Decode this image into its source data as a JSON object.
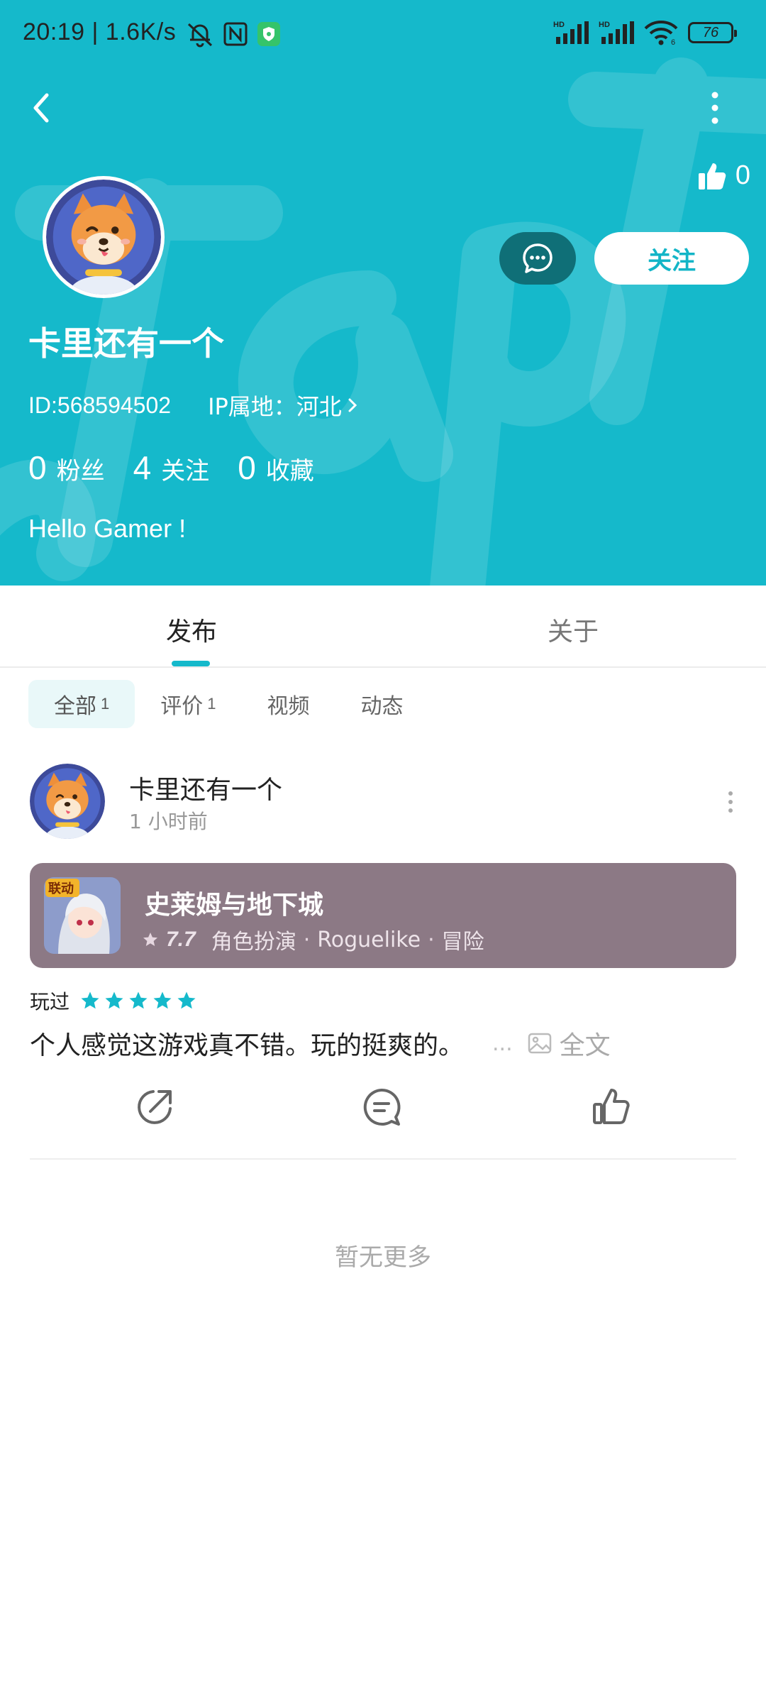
{
  "status_bar": {
    "time": "20:19 | 1.6K/s",
    "battery": "76",
    "net_left": "HD",
    "net_right": "HD",
    "wifi_badge": "6"
  },
  "header": {
    "bg_color": "#15b9cb",
    "likes_count": "0",
    "follow_label": "关注",
    "username": "卡里还有一个",
    "user_id": "ID:568594502",
    "ip_location": "IP属地：河北",
    "stats": [
      {
        "num": "0",
        "label": "粉丝"
      },
      {
        "num": "4",
        "label": "关注"
      },
      {
        "num": "0",
        "label": "收藏"
      }
    ],
    "bio": "Hello Gamer !"
  },
  "tabs": [
    {
      "label": "发布",
      "active": true
    },
    {
      "label": "关于",
      "active": false
    }
  ],
  "filters": [
    {
      "label": "全部",
      "count": "1",
      "active": true
    },
    {
      "label": "评价",
      "count": "1",
      "active": false
    },
    {
      "label": "视频",
      "count": "",
      "active": false
    },
    {
      "label": "动态",
      "count": "",
      "active": false
    }
  ],
  "post": {
    "author": "卡里还有一个",
    "time": "1 小时前",
    "game": {
      "name": "史莱姆与地下城",
      "score": "7.7",
      "tags": [
        "角色扮演",
        "Roguelike",
        "冒险"
      ],
      "icon_badge": "联动",
      "card_color": "#8c7985"
    },
    "played_label": "玩过",
    "rating": 5,
    "text": "个人感觉这游戏真不错。玩的挺爽的。",
    "ellipsis": "...",
    "full_label": "全文"
  },
  "footer": {
    "no_more": "暂无更多"
  },
  "accent_color": "#15b9cb"
}
